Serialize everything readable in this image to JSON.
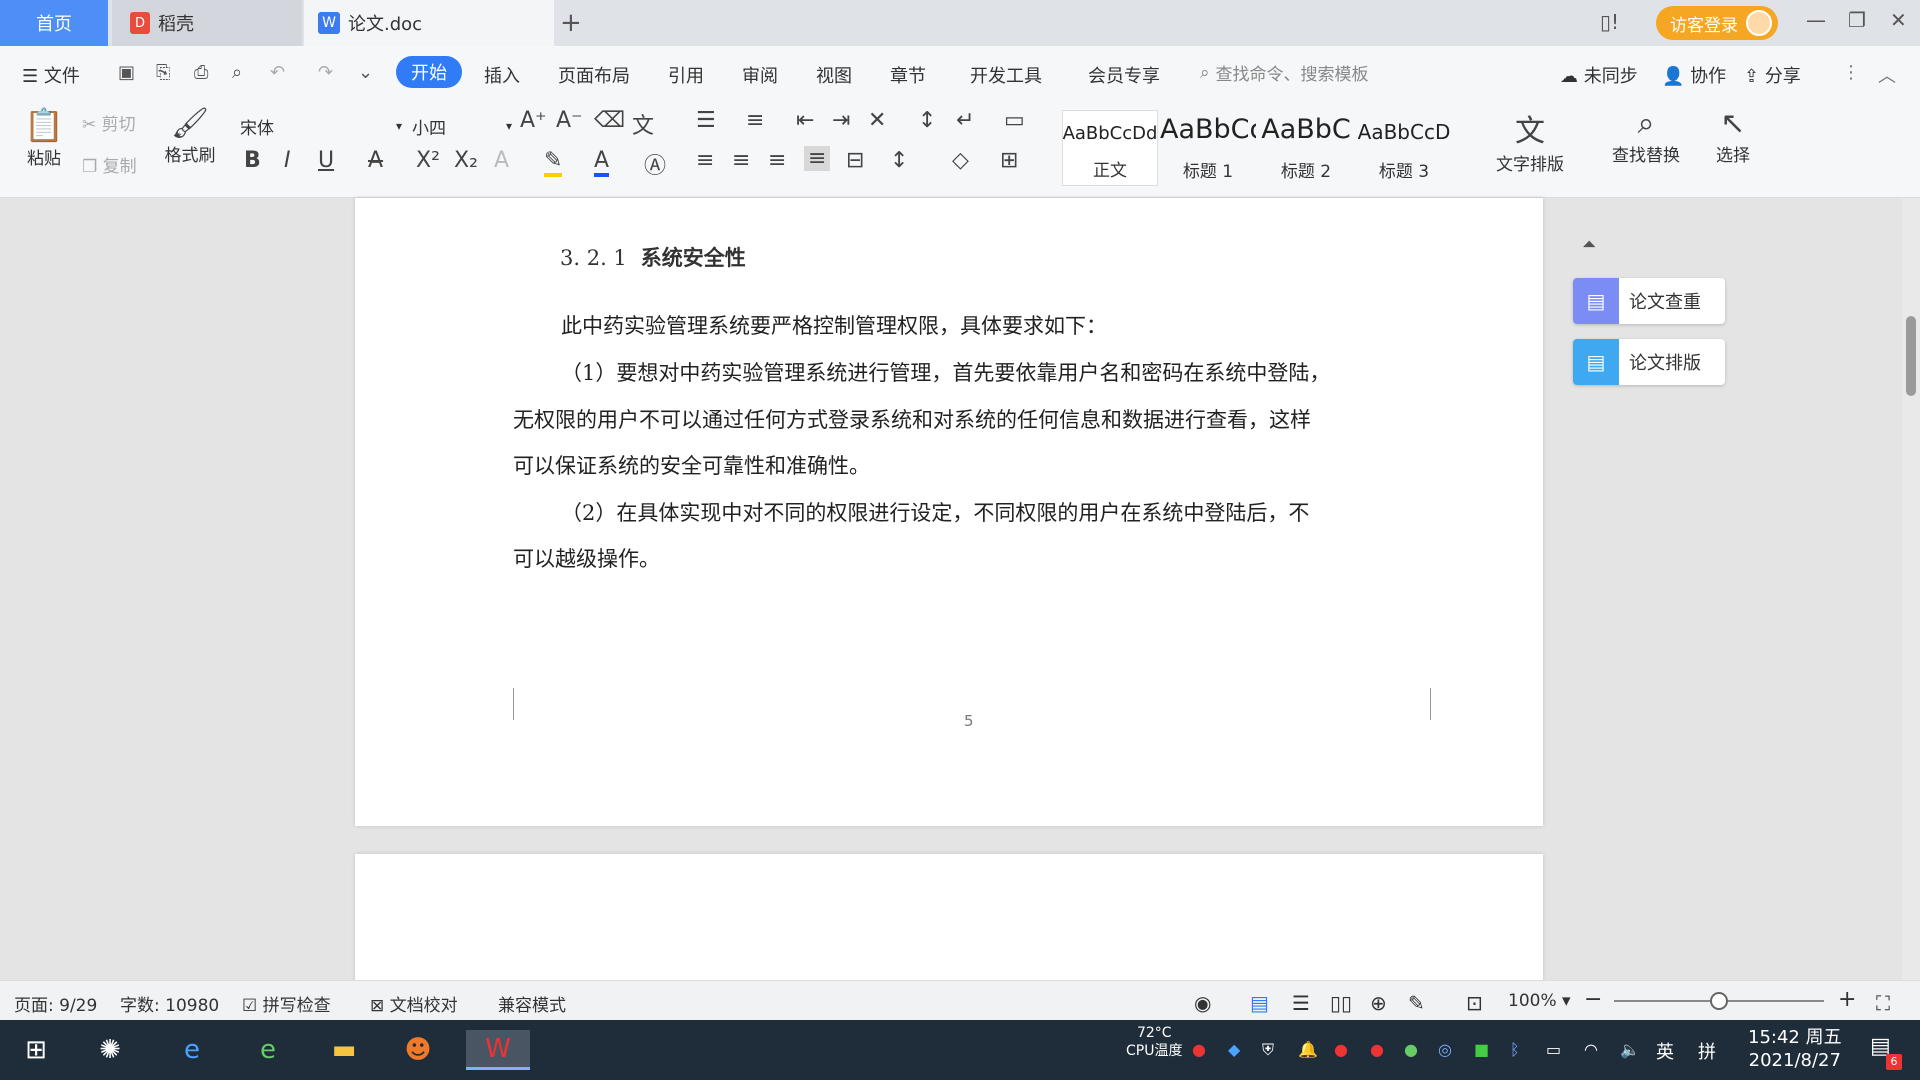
{
  "titlebar": {
    "tabs": [
      {
        "label": "首页"
      },
      {
        "label": "稻壳"
      },
      {
        "label": "论文.doc"
      }
    ],
    "new_tab": "+",
    "login_label": "访客登录"
  },
  "menubar": {
    "file_label": "文件",
    "items": [
      "开始",
      "插入",
      "页面布局",
      "引用",
      "审阅",
      "视图",
      "章节",
      "开发工具",
      "会员专享"
    ],
    "search_placeholder": "查找命令、搜索模板",
    "right": [
      "未同步",
      "协作",
      "分享"
    ]
  },
  "ribbon": {
    "paste_label": "粘贴",
    "cut_label": "剪切",
    "copy_label": "复制",
    "format_painter_label": "格式刷",
    "font_family": "宋体",
    "font_size": "小四",
    "styles": [
      {
        "preview": "AaBbCcDd",
        "name": "正文"
      },
      {
        "preview": "AaBbCc",
        "name": "标题 1"
      },
      {
        "preview": "AaBbC",
        "name": "标题 2"
      },
      {
        "preview": "AaBbCcD",
        "name": "标题 3"
      }
    ],
    "text_layout_label": "文字排版",
    "find_replace_label": "查找替换",
    "select_label": "选择"
  },
  "document": {
    "heading_num": "3. 2. 1",
    "heading_text": "系统安全性",
    "paragraphs": [
      "此中药实验管理系统要严格控制管理权限，具体要求如下：",
      "（1）要想对中药实验管理系统进行管理，首先要依靠用户名和密码在系统中登陆，",
      "无权限的用户不可以通过任何方式登录系统和对系统的任何信息和数据进行查看，这样",
      "可以保证系统的安全可靠性和准确性。",
      "（2）在具体实现中对不同的权限进行设定，不同权限的用户在系统中登陆后，不",
      "可以越级操作。"
    ],
    "page_number": "5"
  },
  "sidepanel": {
    "items": [
      {
        "label": "论文查重",
        "color": "#7b8cf5"
      },
      {
        "label": "论文排版",
        "color": "#3ea8f0"
      }
    ]
  },
  "statusbar": {
    "page": "页面: 9/29",
    "words": "字数: 10980",
    "spell_check": "拼写检查",
    "doc_proof": "文档校对",
    "compat_mode": "兼容模式",
    "zoom": "100%",
    "zoom_fraction": 0.5
  },
  "taskbar": {
    "tray_lang": "英",
    "cpu_temp": "72°C",
    "cpu_label": "CPU温度",
    "time": "15:42 周五",
    "date": "2021/8/27",
    "notif_count": "6"
  },
  "colors": {
    "accent": "#2f7cf6",
    "login": "#f5a623",
    "taskbar": "#1f2c3a"
  }
}
